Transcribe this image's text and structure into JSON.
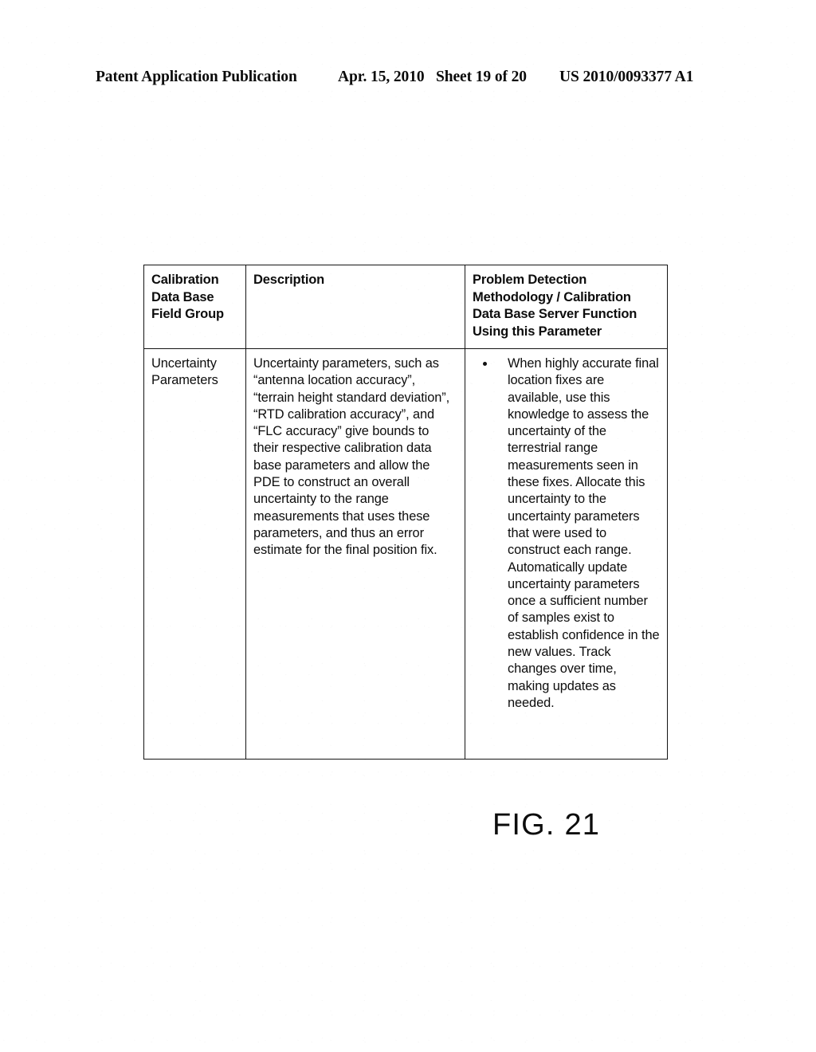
{
  "page_header": {
    "publication": "Patent Application Publication",
    "date": "Apr. 15, 2010",
    "sheet": "Sheet 19 of 20",
    "patent_number": "US 2010/0093377 A1"
  },
  "table": {
    "columns": [
      "Calibration\nData Base\nField Group",
      "Description",
      "Problem Detection\nMethodology / Calibration\nData Base Server Function\nUsing this Parameter"
    ],
    "rows": [
      {
        "field_group": "Uncertainty\nParameters",
        "description": "Uncertainty parameters, such as “antenna location accuracy”, “terrain height standard deviation”, “RTD calibration accuracy”, and “FLC accuracy” give bounds to their respective calibration data base parameters and allow the PDE to construct an overall uncertainty to the range measurements that uses these parameters, and thus an error estimate for the final position fix.",
        "methodology_bullets": [
          "When highly accurate final location fixes are available, use this knowledge to assess the uncertainty of the terrestrial range measurements seen in these fixes. Allocate this uncertainty to the uncertainty parameters that were used to construct each range. Automatically update uncertainty parameters once a sufficient number of samples exist to establish confidence in the new values. Track changes over time, making updates as needed."
        ]
      }
    ]
  },
  "figure": {
    "caption": "FIG. 21"
  },
  "colors": {
    "ink": "#0d0d0d",
    "page_background": "#ffffff",
    "border": "#141414"
  }
}
